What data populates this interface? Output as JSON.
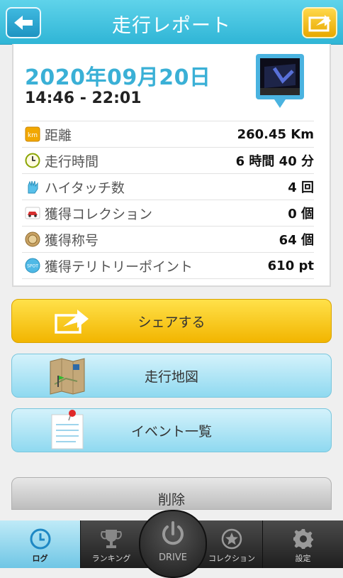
{
  "header": {
    "title": "走行レポート"
  },
  "report": {
    "date": "2020年09月20日",
    "time": "14:46 - 22:01",
    "stats": [
      {
        "label": "距離",
        "value": "260.45 Km",
        "icon": "km-icon"
      },
      {
        "label": "走行時間",
        "value": "6 時間 40 分",
        "icon": "clock-icon"
      },
      {
        "label": "ハイタッチ数",
        "value": "4 回",
        "icon": "high-five-icon"
      },
      {
        "label": "獲得コレクション",
        "value": "0 個",
        "icon": "car-icon"
      },
      {
        "label": "獲得称号",
        "value": "64 個",
        "icon": "medal-icon"
      },
      {
        "label": "獲得テリトリーポイント",
        "value": "610 pt",
        "icon": "spot-icon"
      }
    ],
    "km_icon_text": "km",
    "spot_icon_text": "SPOT"
  },
  "actions": {
    "share": "シェアする",
    "map": "走行地図",
    "events": "イベント一覧",
    "delete": "削除"
  },
  "tabs": {
    "log": "ログ",
    "ranking": "ランキング",
    "drive": "DRIVE",
    "collection": "コレクション",
    "settings": "設定"
  },
  "colors": {
    "accent": "#3ab0d6",
    "share_yellow": "#f2b500",
    "header_blue": "#2fb5d6"
  }
}
